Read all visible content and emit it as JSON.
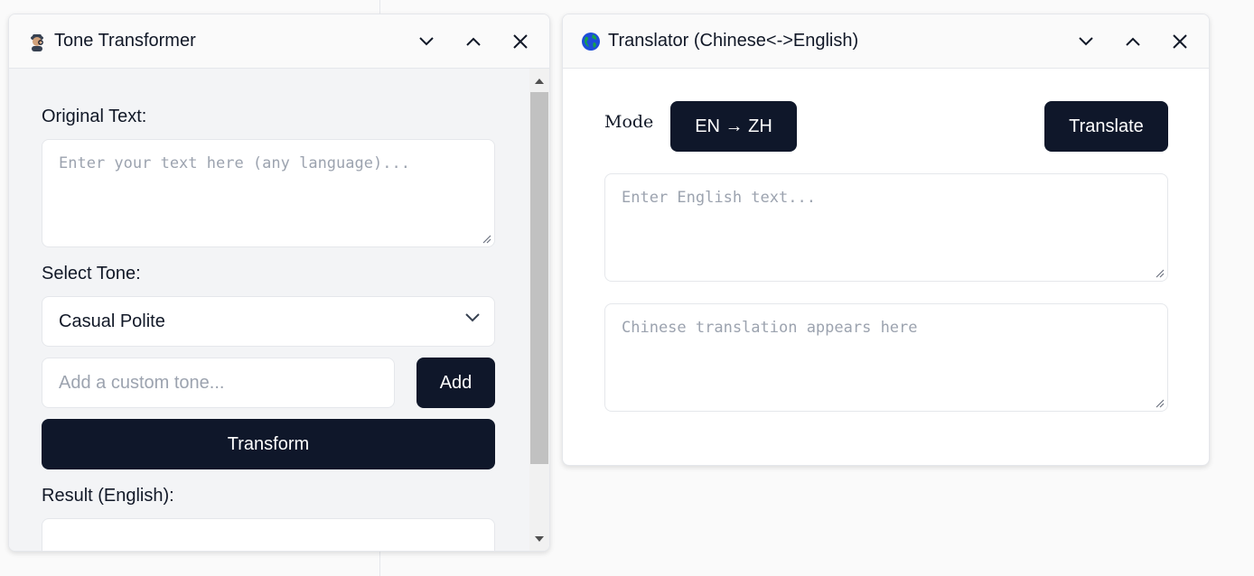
{
  "tone_transformer": {
    "title": "Tone Transformer",
    "icon": "detective-icon",
    "original_text_label": "Original Text:",
    "original_text_placeholder": "Enter your text here (any language)...",
    "select_tone_label": "Select Tone:",
    "selected_tone": "Casual Polite",
    "custom_tone_placeholder": "Add a custom tone...",
    "add_label": "Add",
    "transform_label": "Transform",
    "result_label": "Result (English):"
  },
  "translator": {
    "title": "Translator (Chinese<->English)",
    "icon": "globe-icon",
    "mode_label": "Mode",
    "mode_value": "EN → ZH",
    "translate_label": "Translate",
    "input_placeholder": "Enter English text...",
    "output_placeholder": "Chinese translation appears here"
  },
  "colors": {
    "primary_dark": "#0f172a",
    "panel_bg": "#f3f4f6",
    "border": "#e5e7eb",
    "placeholder": "#9ca3af"
  }
}
